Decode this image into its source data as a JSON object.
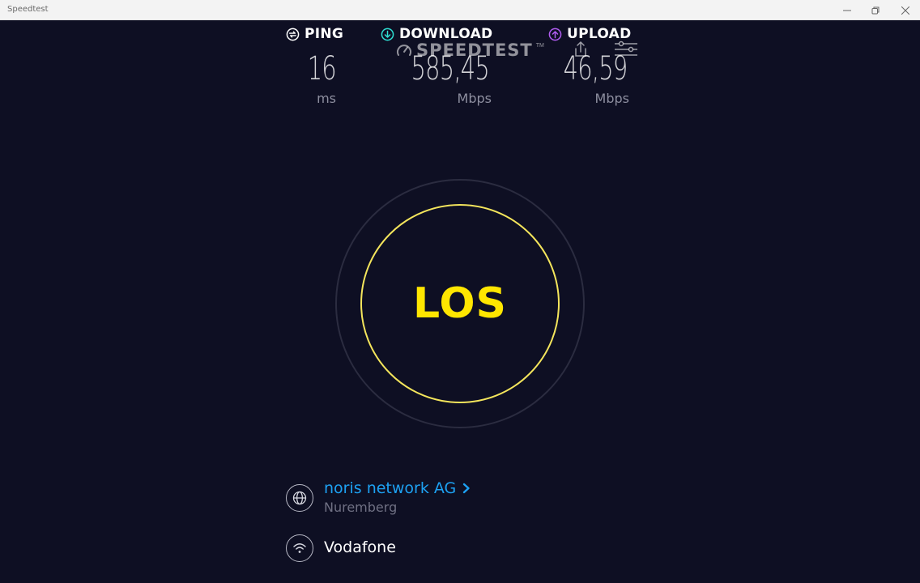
{
  "window": {
    "title": "Speedtest"
  },
  "brand": {
    "logo_text": "SPEEDTEST",
    "logo_mark": "TM"
  },
  "colors": {
    "background": "#0e0f23",
    "ping_accent": "#ffffff",
    "download_accent": "#2fe0d4",
    "upload_accent": "#b05cf0",
    "go_ring": "#f4e55c",
    "go_text": "#ffe600",
    "server_link": "#1da1f2"
  },
  "metrics": {
    "ping": {
      "label": "PING",
      "value": "16",
      "unit": "ms",
      "icon": "ping-icon"
    },
    "download": {
      "label": "DOWNLOAD",
      "value": "585,45",
      "unit": "Mbps",
      "icon": "download-arrow-icon"
    },
    "upload": {
      "label": "UPLOAD",
      "value": "46,59",
      "unit": "Mbps",
      "icon": "upload-arrow-icon"
    }
  },
  "go_button": {
    "label": "LOS"
  },
  "server": {
    "name": "noris network AG",
    "location": "Nuremberg",
    "icon": "globe-icon"
  },
  "connection": {
    "isp": "Vodafone",
    "icon": "wifi-icon"
  }
}
